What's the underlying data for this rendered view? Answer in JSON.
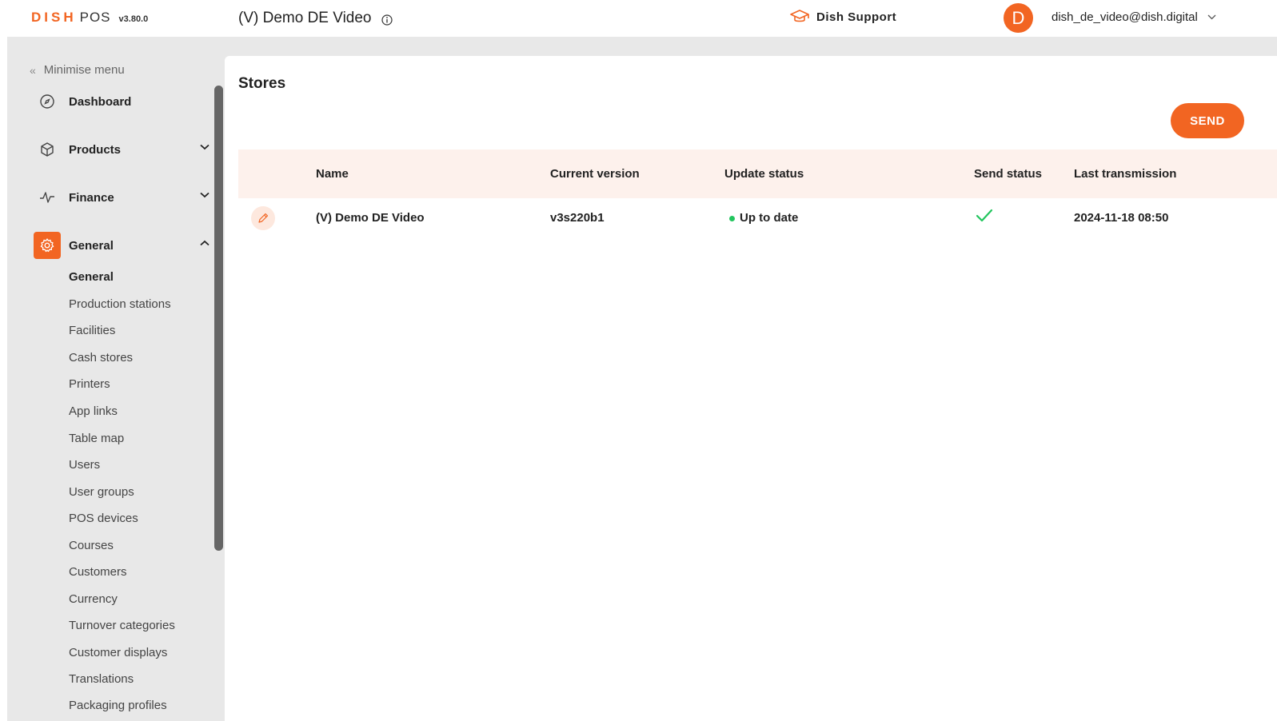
{
  "header": {
    "logo_brand": "DISH",
    "logo_product": "POS",
    "version": "v3.80.0",
    "store_name": "(V) Demo DE Video",
    "support_label": "Dish Support",
    "avatar_initial": "D",
    "user_email": "dish_de_video@dish.digital"
  },
  "sidebar": {
    "minimise_label": "Minimise menu",
    "items": [
      {
        "label": "Dashboard",
        "icon": "compass-icon"
      },
      {
        "label": "Products",
        "icon": "box-icon"
      },
      {
        "label": "Finance",
        "icon": "pulse-icon"
      },
      {
        "label": "General",
        "icon": "gear-icon",
        "active": true
      }
    ],
    "sub_items": [
      {
        "label": "General",
        "active": true
      },
      {
        "label": "Production stations"
      },
      {
        "label": "Facilities"
      },
      {
        "label": "Cash stores"
      },
      {
        "label": "Printers"
      },
      {
        "label": "App links"
      },
      {
        "label": "Table map"
      },
      {
        "label": "Users"
      },
      {
        "label": "User groups"
      },
      {
        "label": "POS devices"
      },
      {
        "label": "Courses"
      },
      {
        "label": "Customers"
      },
      {
        "label": "Currency"
      },
      {
        "label": "Turnover categories"
      },
      {
        "label": "Customer displays"
      },
      {
        "label": "Translations"
      },
      {
        "label": "Packaging profiles"
      }
    ]
  },
  "main": {
    "title": "Stores",
    "send_label": "SEND",
    "columns": [
      "Name",
      "Current version",
      "Update status",
      "Send status",
      "Last transmission"
    ],
    "rows": [
      {
        "name": "(V) Demo DE Video",
        "current_version": "v3s220b1",
        "update_status": "Up to date",
        "send_status": "check-icon",
        "last_transmission": "2024-11-18 08:50"
      }
    ]
  },
  "colors": {
    "accent": "#f26522",
    "header_row_bg": "#fdf1ec",
    "status_ok": "#22c55e"
  }
}
